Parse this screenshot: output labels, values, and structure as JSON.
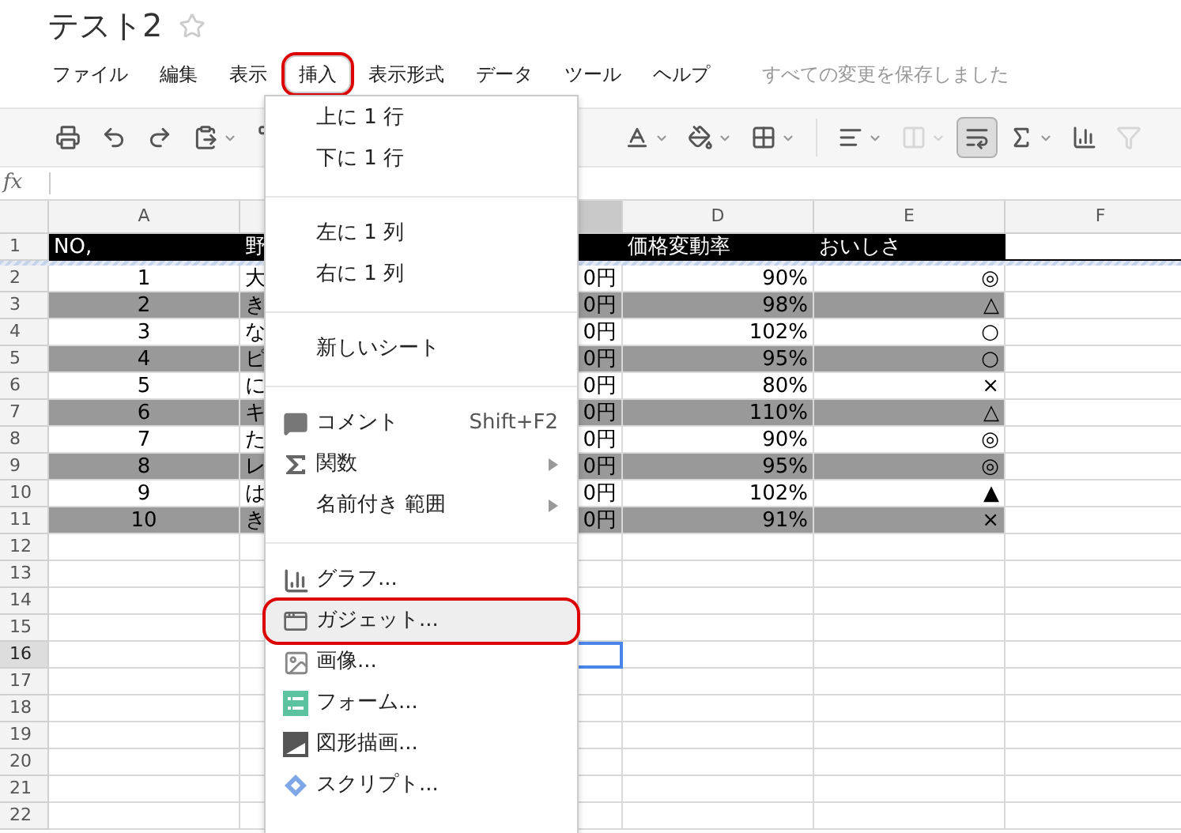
{
  "document": {
    "title": "テスト2",
    "starred": false
  },
  "menu_bar": {
    "items": [
      {
        "label": "ファイル",
        "selected": false,
        "circled": false
      },
      {
        "label": "編集",
        "selected": false,
        "circled": false
      },
      {
        "label": "表示",
        "selected": false,
        "circled": false
      },
      {
        "label": "挿入",
        "selected": true,
        "circled": true
      },
      {
        "label": "表示形式",
        "selected": false,
        "circled": false
      },
      {
        "label": "データ",
        "selected": false,
        "circled": false
      },
      {
        "label": "ツール",
        "selected": false,
        "circled": false
      },
      {
        "label": "ヘルプ",
        "selected": false,
        "circled": false
      }
    ],
    "save_status": "すべての変更を保存しました"
  },
  "toolbar": {
    "left": [
      {
        "kind": "print",
        "selected": false,
        "disabled": false,
        "dropdown": false
      },
      {
        "kind": "undo",
        "selected": false,
        "disabled": false,
        "dropdown": false
      },
      {
        "kind": "redo",
        "selected": false,
        "disabled": false,
        "dropdown": false
      },
      {
        "kind": "paste",
        "selected": false,
        "disabled": false,
        "dropdown": true
      },
      {
        "kind": "paint_format",
        "selected": false,
        "disabled": false,
        "dropdown": false
      }
    ],
    "right": [
      {
        "kind": "text_color",
        "selected": false,
        "disabled": false,
        "dropdown": true
      },
      {
        "kind": "fill_color",
        "selected": false,
        "disabled": false,
        "dropdown": true
      },
      {
        "kind": "borders",
        "selected": false,
        "disabled": false,
        "dropdown": true
      },
      {
        "kind": "align",
        "selected": false,
        "disabled": false,
        "dropdown": true
      },
      {
        "kind": "merge",
        "selected": false,
        "disabled": true,
        "dropdown": true
      },
      {
        "kind": "wrap",
        "selected": true,
        "disabled": false,
        "dropdown": false
      },
      {
        "kind": "sum",
        "selected": false,
        "disabled": false,
        "dropdown": true
      },
      {
        "kind": "chart",
        "selected": false,
        "disabled": false,
        "dropdown": false
      },
      {
        "kind": "filter",
        "selected": false,
        "disabled": true,
        "dropdown": false
      }
    ]
  },
  "formula_bar": {
    "label": "fx"
  },
  "sheet": {
    "columns": [
      {
        "label": "A",
        "selected": false
      },
      {
        "selected": false
      },
      {
        "selected": true
      },
      {
        "label": "D",
        "selected": false
      },
      {
        "label": "E",
        "selected": false
      },
      {
        "label": "F",
        "selected": false
      }
    ],
    "rows": [
      {
        "number": "1",
        "kind": "header",
        "selected": false,
        "a": "NO,",
        "b": "野",
        "d": "価格変動率",
        "e": "おいしさ"
      },
      {
        "number": "2",
        "kind": "data",
        "selected": false,
        "shaded": false,
        "a": "1",
        "b": "大",
        "c": "0円",
        "d": "90%",
        "e": "◎"
      },
      {
        "number": "3",
        "kind": "data",
        "selected": false,
        "shaded": true,
        "a": "2",
        "b": "き",
        "c": "0円",
        "d": "98%",
        "e": "△"
      },
      {
        "number": "4",
        "kind": "data",
        "selected": false,
        "shaded": false,
        "a": "3",
        "b": "な",
        "c": "0円",
        "d": "102%",
        "e": "○"
      },
      {
        "number": "5",
        "kind": "data",
        "selected": false,
        "shaded": true,
        "a": "4",
        "b": "ピ",
        "c": "0円",
        "d": "95%",
        "e": "○"
      },
      {
        "number": "6",
        "kind": "data",
        "selected": false,
        "shaded": false,
        "a": "5",
        "b": "に",
        "c": "0円",
        "d": "80%",
        "e": "×"
      },
      {
        "number": "7",
        "kind": "data",
        "selected": false,
        "shaded": true,
        "a": "6",
        "b": "キ",
        "c": "0円",
        "d": "110%",
        "e": "△"
      },
      {
        "number": "8",
        "kind": "data",
        "selected": false,
        "shaded": false,
        "a": "7",
        "b": "た",
        "c": "0円",
        "d": "90%",
        "e": "◎"
      },
      {
        "number": "9",
        "kind": "data",
        "selected": false,
        "shaded": true,
        "a": "8",
        "b": "レ",
        "c": "0円",
        "d": "95%",
        "e": "◎"
      },
      {
        "number": "10",
        "kind": "data",
        "selected": false,
        "shaded": false,
        "a": "9",
        "b": "は",
        "c": "0円",
        "d": "102%",
        "e": "▲"
      },
      {
        "number": "11",
        "kind": "data",
        "selected": false,
        "shaded": true,
        "a": "10",
        "b": "き",
        "c": "0円",
        "d": "91%",
        "e": "×"
      },
      {
        "number": "12",
        "kind": "empty",
        "selected": false
      },
      {
        "number": "13",
        "kind": "empty",
        "selected": false
      },
      {
        "number": "14",
        "kind": "empty",
        "selected": false
      },
      {
        "number": "15",
        "kind": "empty",
        "selected": false
      },
      {
        "number": "16",
        "kind": "empty",
        "selected": true
      },
      {
        "number": "17",
        "kind": "empty",
        "selected": false
      },
      {
        "number": "18",
        "kind": "empty",
        "selected": false
      },
      {
        "number": "19",
        "kind": "empty",
        "selected": false
      },
      {
        "number": "20",
        "kind": "empty",
        "selected": false
      },
      {
        "number": "21",
        "kind": "empty",
        "selected": false
      },
      {
        "number": "22",
        "kind": "empty",
        "selected": false
      }
    ]
  },
  "insert_menu": {
    "sections": [
      [
        {
          "label": "上に 1 行",
          "kind": "plain",
          "highlighted": false,
          "circled": false,
          "submenu": false
        },
        {
          "label": "下に 1 行",
          "kind": "plain",
          "highlighted": false,
          "circled": false,
          "submenu": false
        }
      ],
      [
        {
          "label": "左に 1 列",
          "kind": "plain",
          "highlighted": false,
          "circled": false,
          "submenu": false
        },
        {
          "label": "右に 1 列",
          "kind": "plain",
          "highlighted": false,
          "circled": false,
          "submenu": false
        }
      ],
      [
        {
          "label": "新しいシート",
          "kind": "plain",
          "highlighted": false,
          "circled": false,
          "submenu": false
        }
      ],
      [
        {
          "label": "コメント",
          "kind": "comment",
          "shortcut": "Shift+F2",
          "highlighted": false,
          "circled": false,
          "submenu": false
        },
        {
          "label": "関数",
          "kind": "function",
          "highlighted": false,
          "circled": false,
          "submenu": true
        },
        {
          "label": "名前付き 範囲",
          "kind": "plain",
          "highlighted": false,
          "circled": false,
          "submenu": true
        }
      ],
      [
        {
          "label": "グラフ...",
          "kind": "chart",
          "highlighted": false,
          "circled": false,
          "submenu": false
        },
        {
          "label": "ガジェット...",
          "kind": "gadget",
          "highlighted": true,
          "circled": true,
          "submenu": false
        },
        {
          "label": "画像...",
          "kind": "image",
          "highlighted": false,
          "circled": false,
          "submenu": false
        },
        {
          "label": "フォーム...",
          "kind": "form",
          "highlighted": false,
          "circled": false,
          "submenu": false
        },
        {
          "label": "図形描画...",
          "kind": "drawing",
          "highlighted": false,
          "circled": false,
          "submenu": false
        },
        {
          "label": "スクリプト...",
          "kind": "script",
          "highlighted": false,
          "circled": false,
          "submenu": false
        }
      ]
    ]
  }
}
